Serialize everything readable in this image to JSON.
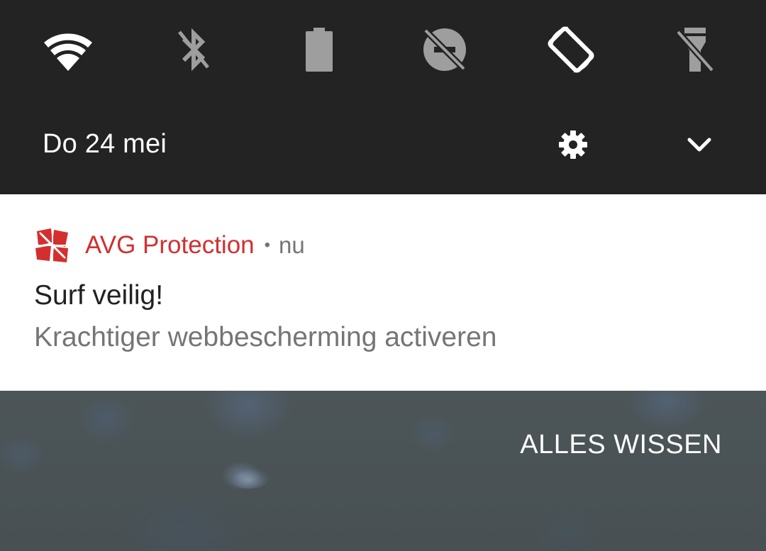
{
  "quick_settings": {
    "tiles": [
      {
        "icon": "wifi-icon",
        "active": true
      },
      {
        "icon": "bluetooth-off-icon",
        "active": false
      },
      {
        "icon": "battery-icon",
        "active": false
      },
      {
        "icon": "do-not-disturb-off-icon",
        "active": false
      },
      {
        "icon": "auto-rotate-icon",
        "active": true
      },
      {
        "icon": "flashlight-off-icon",
        "active": false
      }
    ],
    "date": "Do 24 mei",
    "settings_icon": "gear-icon",
    "expand_icon": "chevron-down-icon"
  },
  "notification": {
    "app_icon": "avg-logo",
    "app_name": "AVG Protection",
    "separator": "•",
    "time": "nu",
    "title": "Surf veilig!",
    "text": "Krachtiger webbescherming activeren"
  },
  "clear_all_label": "ALLES WISSEN",
  "colors": {
    "panel_bg": "#232323",
    "active_icon": "#ffffff",
    "inactive_icon": "#9e9e9e",
    "accent_red": "#d32f2f",
    "secondary_text": "#757575"
  }
}
